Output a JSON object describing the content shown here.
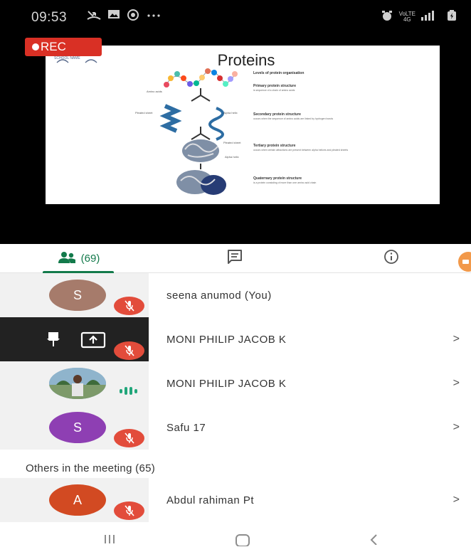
{
  "status_bar": {
    "time": "09:53",
    "left_icons": [
      "missed-call-icon",
      "gallery-icon",
      "vpn-icon",
      "more-icon"
    ],
    "network_label_top": "VoLTE",
    "network_label_bottom": "4G"
  },
  "recording": {
    "label": "REC"
  },
  "slide": {
    "title": "Proteins",
    "logo_text": "SCHOOL NAME",
    "captions": {
      "levels": "Levels of protein organisation",
      "primary_title": "Primary protein structure",
      "primary_desc": "is sequence of a chain of amino acids",
      "secondary_title": "Secondary protein structure",
      "secondary_desc": "occurs when the sequence of amino acids are linked by hydrogen bonds",
      "tertiary_title": "Tertiary protein structure",
      "tertiary_desc": "occurs when certain attractions are present between alpha helices and pleated sheets",
      "quaternary_title": "Quaternary protein structure",
      "quaternary_desc": "is a protein consisting of more than one amino acid chain",
      "amino_acids": "Amino acids",
      "pleated_sheet": "Pleated sheet",
      "alpha_helix": "Alpha helix",
      "pleated_sheet_2": "Pleated sheet",
      "alpha_helix_2": "Alpha helix"
    }
  },
  "tabs": {
    "people_count": "(69)",
    "people_icon": "people-icon",
    "chat_icon": "chat-icon",
    "info_icon": "info-icon"
  },
  "participants": [
    {
      "initial": "S",
      "name": "seena anumod (You)",
      "avatar_color": "#a67b6b",
      "muted": true
    },
    {
      "initial": "",
      "name": "MONI PHILIP JACOB K",
      "muted": true,
      "presenting": true
    },
    {
      "initial": "",
      "name": "MONI PHILIP JACOB K",
      "speaking": true
    },
    {
      "initial": "S",
      "name": "Safu 17",
      "avatar_color": "#8e3fb3",
      "muted": true
    }
  ],
  "others_section": {
    "label": "Others in the meeting (65)"
  },
  "others": [
    {
      "initial": "A",
      "name": "Abdul rahiman Pt",
      "avatar_color": "#d24a22",
      "muted": true
    }
  ],
  "colors": {
    "accent_green": "#137a4b",
    "rec_red": "#d93025",
    "mute_red": "#e24c3b",
    "speaking_teal": "#21a67a"
  }
}
